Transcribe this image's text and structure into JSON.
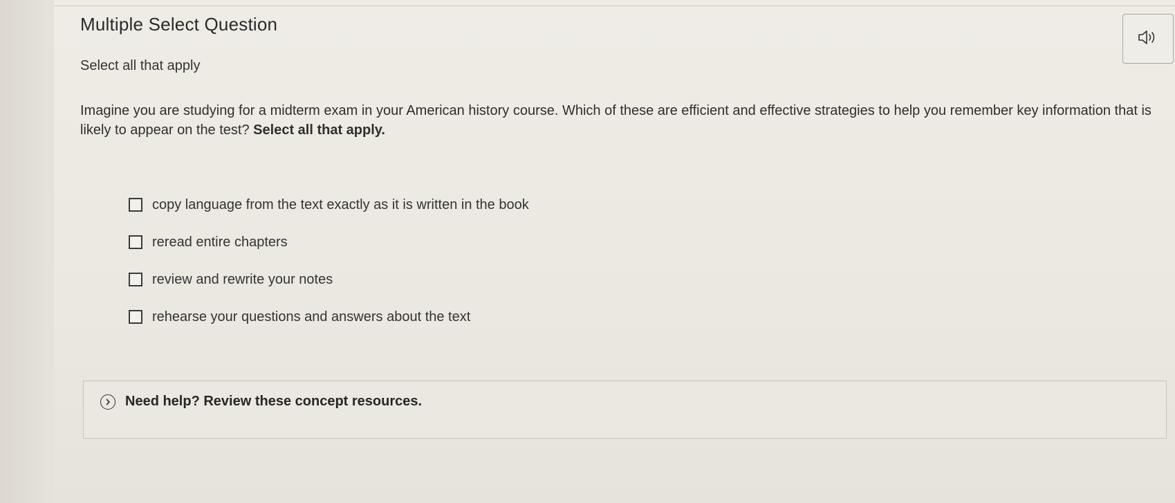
{
  "question": {
    "type_label": "Multiple Select Question",
    "instruction": "Select all that apply",
    "prompt_text": "Imagine you are studying for a midterm exam in your American history course. Which of these are efficient and effective strategies to help you remember key information that is likely to appear on the test?",
    "prompt_emphasis": "Select all that apply."
  },
  "audio": {
    "icon": "speaker-icon"
  },
  "options": [
    {
      "label": "copy language from the text exactly as it is written in the book",
      "checked": false
    },
    {
      "label": "reread entire chapters",
      "checked": false
    },
    {
      "label": "review and rewrite your notes",
      "checked": false
    },
    {
      "label": "rehearse your questions and answers about the text",
      "checked": false
    }
  ],
  "help": {
    "icon": "chevron-right-circle-icon",
    "label": "Need help? Review these concept resources."
  }
}
